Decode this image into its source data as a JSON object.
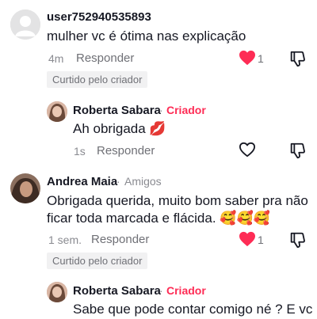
{
  "colors": {
    "like_red": "#fe2c55",
    "creator_pink": "#fe2c55",
    "muted": "#8a8b91"
  },
  "comments": [
    {
      "username": "user752940535893",
      "text_lines": [
        "mulher vc é ótima nas explicação"
      ],
      "time": "4m",
      "reply_label": "Responder",
      "like_count": "1",
      "liked": true,
      "badge": "Curtido pelo criador"
    },
    {
      "username": "Roberta Sabara",
      "creator_label": "Criador",
      "text_lines": [
        "Ah obrigada 💋"
      ],
      "time": "1s",
      "reply_label": "Responder",
      "liked": false
    },
    {
      "username": "Andrea Maia",
      "tag": "Amigos",
      "text_lines": [
        "Obrigada querida, muito bom saber pra não",
        "ficar toda marcada e flácida. 🥰🥰🥰"
      ],
      "time": "1 sem.",
      "reply_label": "Responder",
      "like_count": "1",
      "liked": true,
      "badge": "Curtido pelo criador"
    },
    {
      "username": "Roberta Sabara",
      "creator_label": "Criador",
      "text_lines": [
        "Sabe que pode contar comigo né ? E vc"
      ]
    }
  ],
  "separator": "·",
  "icons": {
    "like": "heart-icon",
    "dislike": "thumbs-down-icon",
    "avatar_default": "default-avatar-icon"
  }
}
